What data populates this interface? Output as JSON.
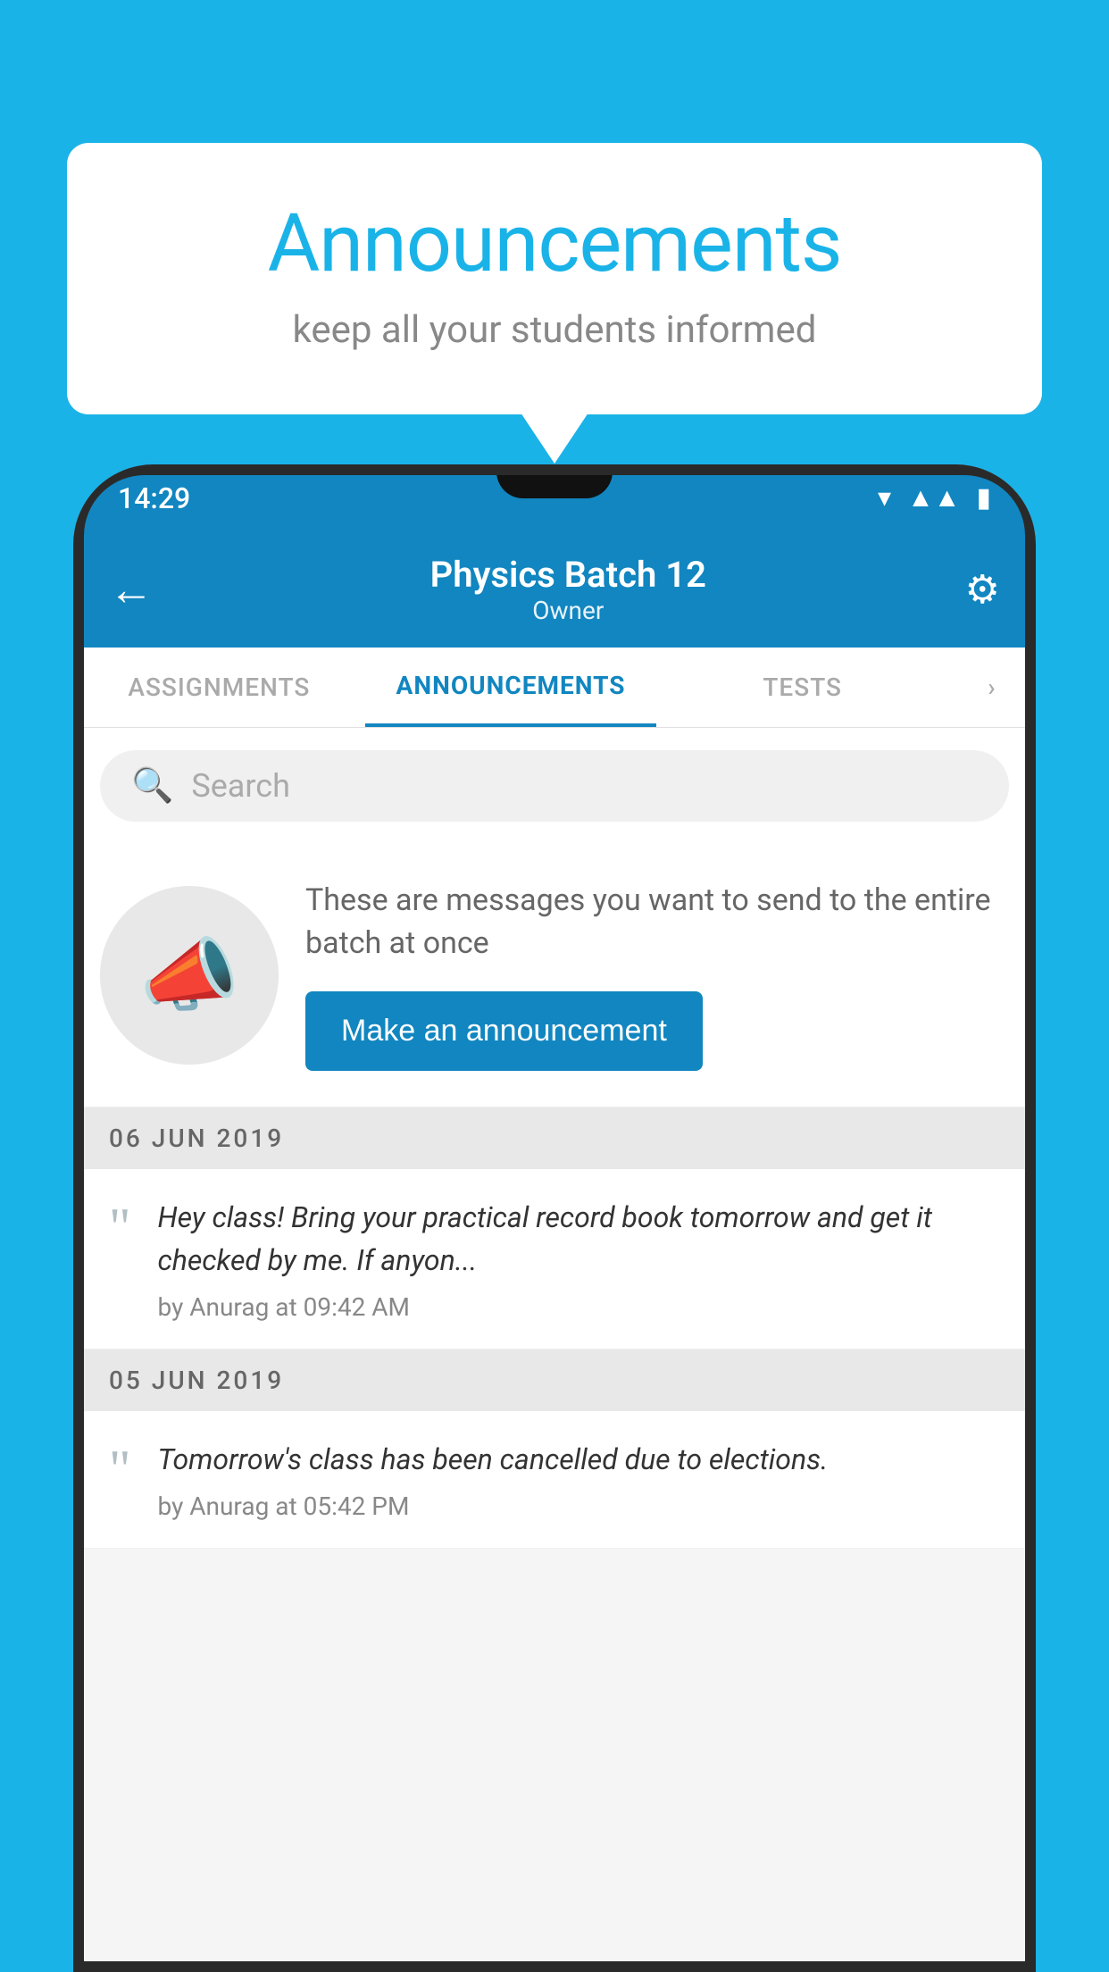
{
  "bubble": {
    "title": "Announcements",
    "subtitle": "keep all your students informed"
  },
  "status_bar": {
    "time": "14:29",
    "wifi": "▾",
    "signal": "▴",
    "battery": "▮"
  },
  "app_bar": {
    "batch_name": "Physics Batch 12",
    "role": "Owner",
    "back_label": "←",
    "settings_label": "⚙"
  },
  "tabs": [
    {
      "label": "ASSIGNMENTS",
      "active": false
    },
    {
      "label": "ANNOUNCEMENTS",
      "active": true
    },
    {
      "label": "TESTS",
      "active": false
    },
    {
      "label": "·",
      "active": false
    }
  ],
  "search": {
    "placeholder": "Search"
  },
  "announcement_banner": {
    "description": "These are messages you want to send to the entire batch at once",
    "button_label": "Make an announcement"
  },
  "announcements": [
    {
      "date": "06  JUN  2019",
      "message": "Hey class! Bring your practical record book tomorrow and get it checked by me. If anyon...",
      "meta": "by Anurag at 09:42 AM"
    },
    {
      "date": "05  JUN  2019",
      "message": "Tomorrow's class has been cancelled due to elections.",
      "meta": "by Anurag at 05:42 PM"
    }
  ]
}
